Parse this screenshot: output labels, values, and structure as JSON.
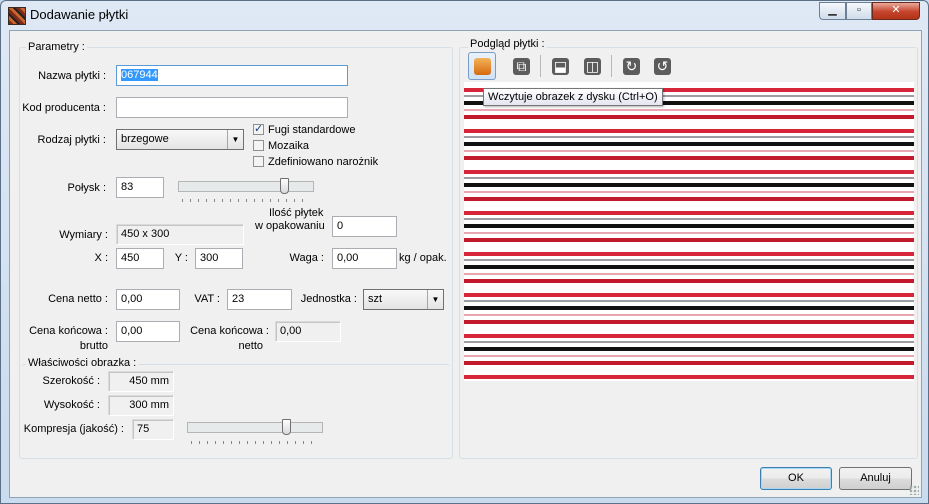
{
  "window": {
    "title": "Dodawanie płytki",
    "min_symbol": "▁",
    "max_symbol": "▫",
    "close_symbol": "✕"
  },
  "parametry": {
    "group_label": "Parametry :",
    "nazwa_label": "Nazwa płytki :",
    "nazwa_value": "067944",
    "kod_label": "Kod producenta :",
    "kod_value": "",
    "rodzaj_label": "Rodzaj płytki :",
    "rodzaj_value": "brzegowe",
    "fugi_label": "Fugi standardowe",
    "fugi_checked": true,
    "mozaika_label": "Mozaika",
    "mozaika_checked": false,
    "naroznik_label": "Zdefiniowano narożnik",
    "naroznik_checked": false,
    "polysk_label": "Połysk :",
    "polysk_value": "83",
    "polysk_slider_fraction": 0.8,
    "ilosc_label_1": "Ilość płytek",
    "ilosc_label_2": "w opakowaniu",
    "ilosc_value": "0",
    "wymiary_label": "Wymiary :",
    "wymiary_value": "450 x 300",
    "x_label": "X :",
    "x_value": "450",
    "y_label": "Y :",
    "y_value": "300",
    "waga_label": "Waga :",
    "waga_value": "0,00",
    "waga_unit": "kg / opak.",
    "cena_netto_label": "Cena netto :",
    "cena_netto_value": "0,00",
    "vat_label": "VAT :",
    "vat_value": "23",
    "jednostka_label": "Jednostka :",
    "jednostka_value": "szt",
    "cena_brutto_label_1": "Cena końcowa :",
    "cena_brutto_label_2": "brutto",
    "cena_brutto_value": "0,00",
    "cena_konc_netto_label_1": "Cena końcowa :",
    "cena_konc_netto_label_2": "netto",
    "cena_konc_netto_value": "0,00"
  },
  "obrazek": {
    "group_label": "Właściwości obrazka :",
    "szerokosc_label": "Szerokość :",
    "szerokosc_value": "450 mm",
    "wysokosc_label": "Wysokość :",
    "wysokosc_value": "300 mm",
    "kompresja_label": "Kompresja (jakość) :",
    "kompresja_value": "75",
    "kompresja_slider_fraction": 0.75
  },
  "podglad": {
    "group_label": "Podgląd płytki :",
    "toolbar": [
      {
        "icon": "folder-open-icon",
        "color": "#e07a1a"
      },
      {
        "icon": "crop-icon",
        "color": "#5a5a5a"
      },
      {
        "icon": "flip-vertical-icon",
        "color": "#5a5a5a"
      },
      {
        "icon": "flip-horizontal-icon",
        "color": "#5a5a5a"
      },
      {
        "icon": "rotate-right-icon",
        "color": "#5a5a5a"
      },
      {
        "icon": "rotate-left-icon",
        "color": "#5a5a5a"
      }
    ],
    "tooltip": "Wczytuje obrazek z dysku (Ctrl+O)"
  },
  "buttons": {
    "ok": "OK",
    "cancel": "Anuluj"
  },
  "colors": {
    "stripe_red": "#d7263a",
    "stripe_black": "#111111",
    "stripe_gray": "#9c9ea3",
    "selection": "#3399ff"
  }
}
